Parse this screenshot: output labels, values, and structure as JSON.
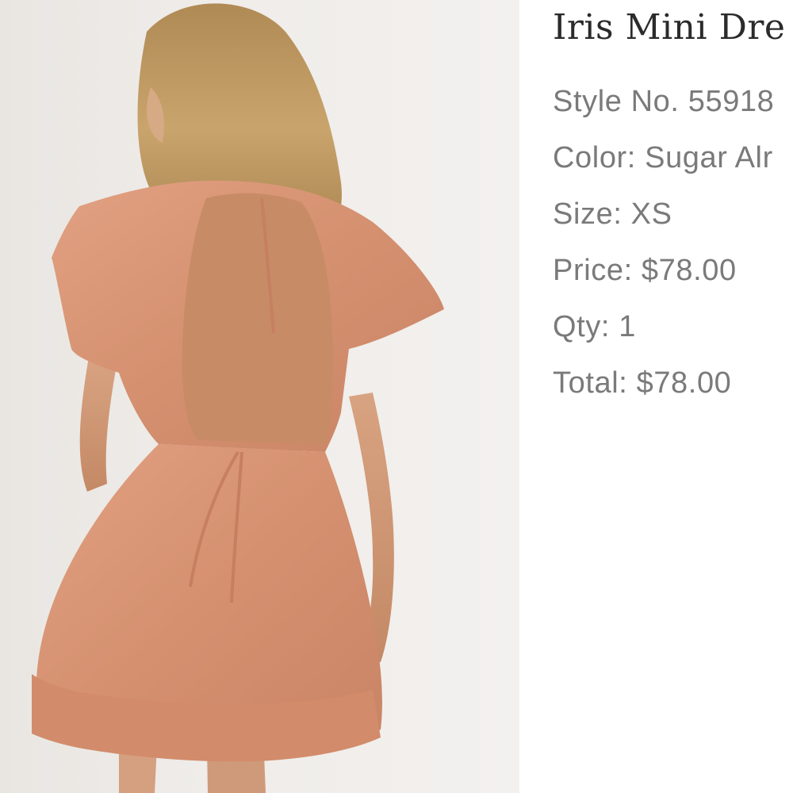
{
  "product": {
    "title": "Iris Mini Dre",
    "image_alt_subject": "photo",
    "accent_color": "#d98e75"
  },
  "order_details": {
    "style_line": "Style No. 55918",
    "color_line": "Color: Sugar Alr",
    "size_line": "Size: XS",
    "price_line": "Price: $78.00",
    "qty_line": "Qty: 1",
    "total_line": "Total: $78.00"
  }
}
